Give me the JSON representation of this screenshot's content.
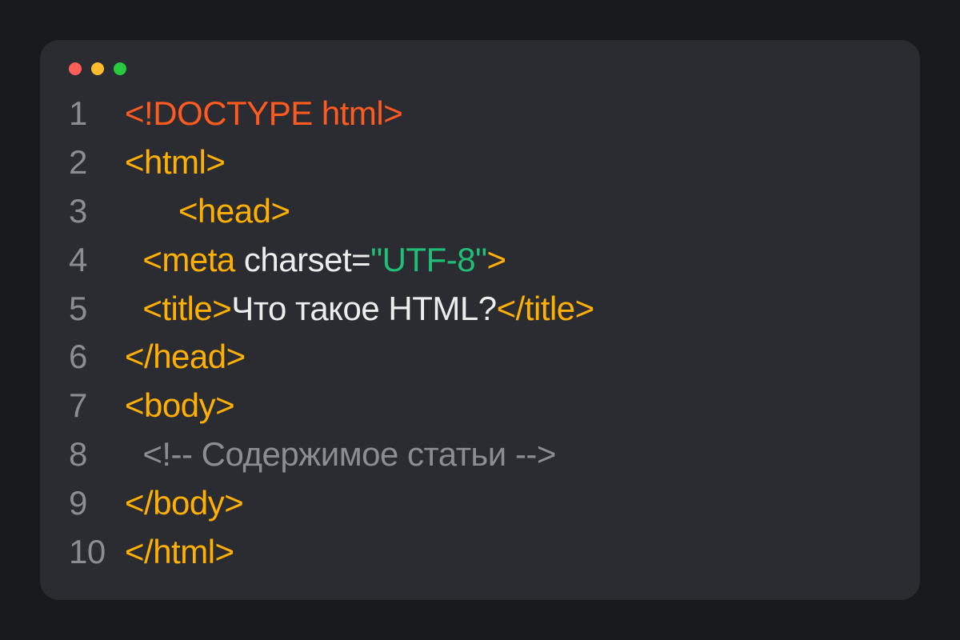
{
  "window": {
    "traffic_lights": [
      "red",
      "yellow",
      "green"
    ]
  },
  "syntax_colors": {
    "doctype": "#ff5a1f",
    "tag": "#ffb000",
    "attr_name": "#eceded",
    "string": "#1fbf75",
    "text": "#eceded",
    "comment": "#8b8d93"
  },
  "code": {
    "lines": [
      {
        "num": "1",
        "indent": "",
        "tokens": [
          {
            "t": "doctype",
            "v": "<!DOCTYPE html>"
          }
        ]
      },
      {
        "num": "2",
        "indent": "",
        "tokens": [
          {
            "t": "tag",
            "v": "<html>"
          }
        ]
      },
      {
        "num": "3",
        "indent": "      ",
        "tokens": [
          {
            "t": "tag",
            "v": "<head>"
          }
        ]
      },
      {
        "num": "4",
        "indent": "  ",
        "tokens": [
          {
            "t": "tag",
            "v": "<meta "
          },
          {
            "t": "attr",
            "v": "charset="
          },
          {
            "t": "string",
            "v": "\"UTF-8\""
          },
          {
            "t": "tag",
            "v": ">"
          }
        ]
      },
      {
        "num": "5",
        "indent": "  ",
        "tokens": [
          {
            "t": "tag",
            "v": "<title>"
          },
          {
            "t": "text",
            "v": "Что такое HTML?"
          },
          {
            "t": "tag",
            "v": "</title>"
          }
        ]
      },
      {
        "num": "6",
        "indent": "",
        "tokens": [
          {
            "t": "tag",
            "v": "</head>"
          }
        ]
      },
      {
        "num": "7",
        "indent": "",
        "tokens": [
          {
            "t": "tag",
            "v": "<body>"
          }
        ]
      },
      {
        "num": "8",
        "indent": "  ",
        "tokens": [
          {
            "t": "comment",
            "v": "<!-- Содержимое статьи -->"
          }
        ]
      },
      {
        "num": "9",
        "indent": "",
        "tokens": [
          {
            "t": "tag",
            "v": "</body>"
          }
        ]
      },
      {
        "num": "10",
        "indent": "",
        "tokens": [
          {
            "t": "tag",
            "v": "</html>"
          }
        ]
      }
    ]
  }
}
